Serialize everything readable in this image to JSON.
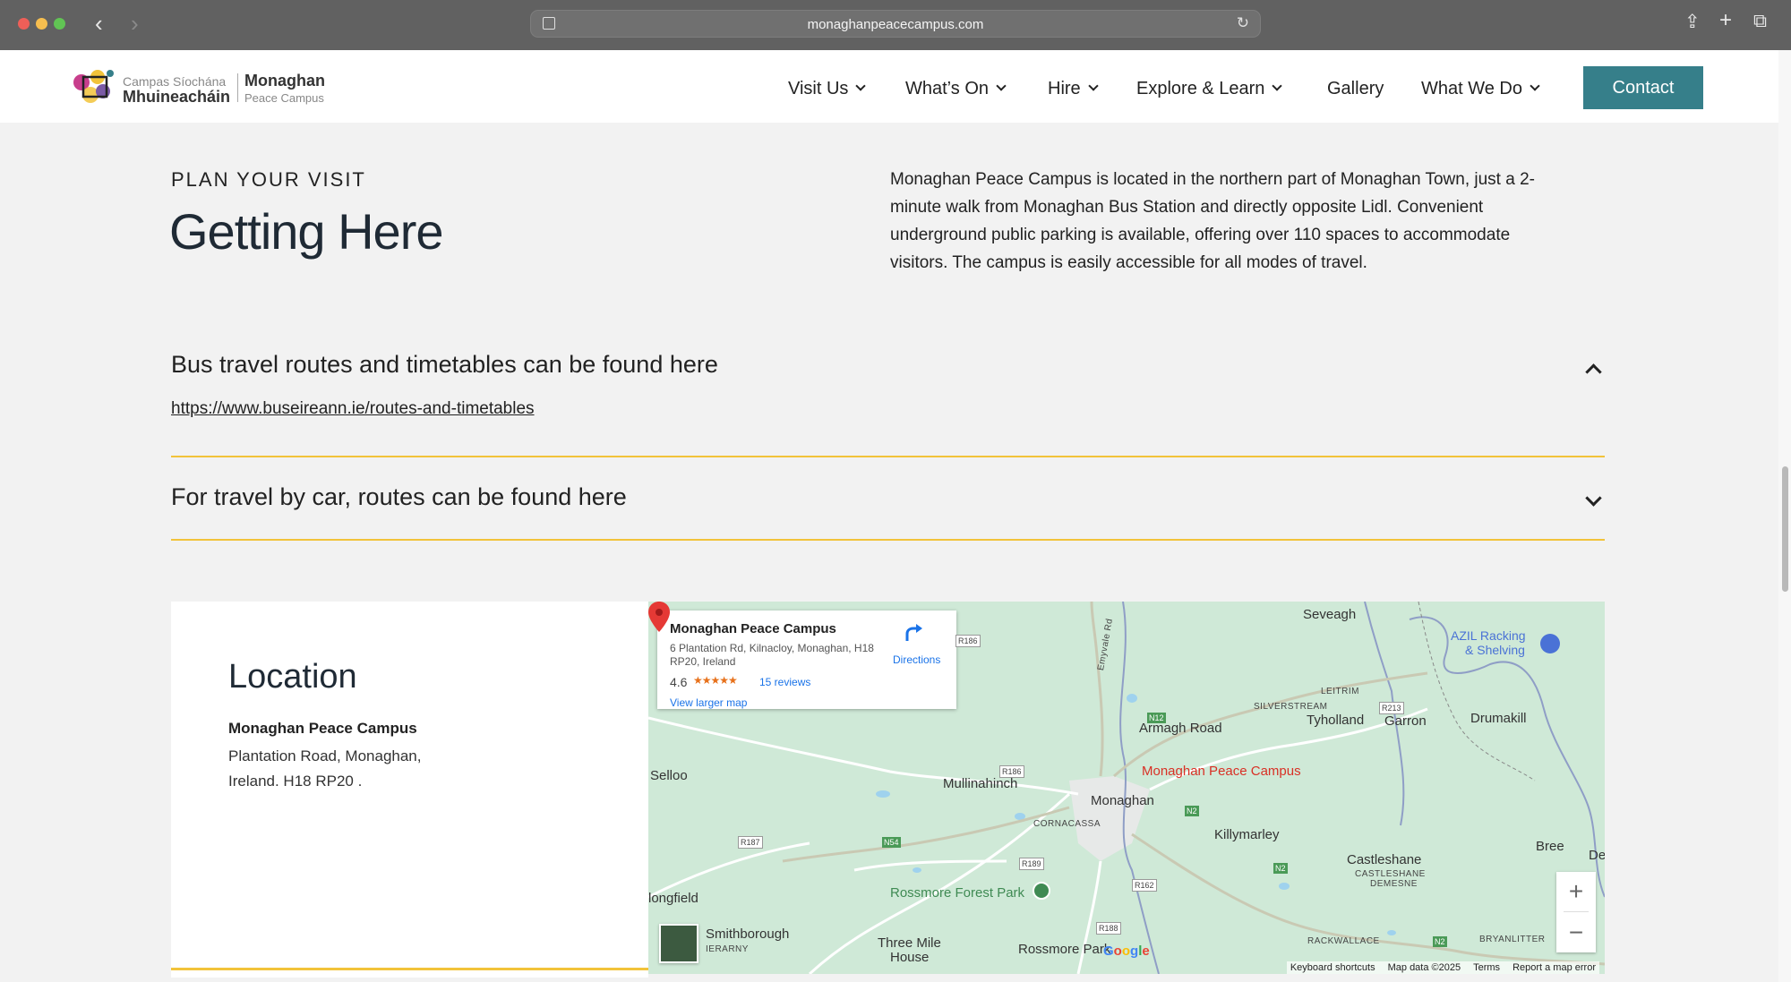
{
  "browser": {
    "url": "monaghanpeacecampus.com"
  },
  "header": {
    "logo": {
      "line1": "Campas Síochána",
      "line2": "Mhuineacháin",
      "line3": "Monaghan",
      "line4": "Peace Campus"
    },
    "nav": [
      {
        "label": "Visit Us",
        "dropdown": true
      },
      {
        "label": "What’s On",
        "dropdown": true
      },
      {
        "label": "Hire",
        "dropdown": true
      },
      {
        "label": "Explore & Learn",
        "dropdown": true
      },
      {
        "label": "Gallery",
        "dropdown": false
      },
      {
        "label": "What We Do",
        "dropdown": true
      }
    ],
    "contact_label": "Contact",
    "accent": "#367f8a"
  },
  "intro": {
    "eyebrow": "PLAN YOUR VISIT",
    "title": "Getting Here",
    "body": "Monaghan Peace Campus is located in the northern part of Monaghan Town, just a 2-minute walk from Monaghan Bus Station and directly opposite Lidl. Convenient underground public parking is available, offering over 110 spaces to accommodate visitors.  The campus is easily accessible for all modes of travel."
  },
  "accordion": [
    {
      "title": "Bus travel routes and timetables can be found here",
      "expanded": true,
      "link": "https://www.buseireann.ie/routes-and-timetables"
    },
    {
      "title": "For travel by car, routes can be found here",
      "expanded": false
    }
  ],
  "location": {
    "title": "Location",
    "name": "Monaghan Peace Campus",
    "address_line1": "Plantation Road, Monaghan,",
    "address_line2": "Ireland. H18 RP20 ."
  },
  "map": {
    "info": {
      "name": "Monaghan Peace Campus",
      "address": "6 Plantation Rd, Kilnacloy, Monaghan, H18 RP20, Ireland",
      "rating": "4.6",
      "stars": "★★★★★",
      "reviews": "15 reviews",
      "view_larger": "View larger map",
      "directions": "Directions"
    },
    "pin_label": "Monaghan Peace Campus",
    "places": {
      "seveagh": "Seveagh",
      "azil": "AZIL Racking",
      "azil2": "& Shelving",
      "leitrim": "LEITRIM",
      "silverstream": "SILVERSTREAM",
      "tyholland": "Tyholland",
      "garron": "Garron",
      "drumakill": "Drumakill",
      "armagh_road": "Armagh Road",
      "emyvale_rd": "Emyvale Rd",
      "selloo": "Selloo",
      "mullinahinch": "Mullinahinch",
      "monaghan": "Monaghan",
      "cornacassa": "CORNACASSA",
      "killymarley": "Killymarley",
      "castleshane": "Castleshane",
      "castleshane_demesne1": "CASTLESHANE",
      "castleshane_demesne2": "DEMESNE",
      "bree": "Bree",
      "de": "De",
      "rossmore_forest_park": "Rossmore Forest Park",
      "longfield": "longfield",
      "smithborough": "Smithborough",
      "ierarny": "IERARNY",
      "three_mile_house1": "Three Mile",
      "three_mile_house2": "House",
      "rossmore_park": "Rossmore Park",
      "rackwallace": "RACKWALLACE",
      "bryanlitter": "BRYANLITTER"
    },
    "roads": {
      "r186a": "R186",
      "r186b": "R186",
      "n12": "N12",
      "r213": "R213",
      "n2a": "N2",
      "n2b": "N2",
      "n2c": "N2",
      "r187": "R187",
      "n54": "N54",
      "r189": "R189",
      "r162": "R162",
      "r188": "R188"
    },
    "google": "Google",
    "attribution": {
      "shortcuts": "Keyboard shortcuts",
      "data": "Map data ©2025",
      "terms": "Terms",
      "report": "Report a map error"
    },
    "zoom_in": "+",
    "zoom_out": "−"
  }
}
